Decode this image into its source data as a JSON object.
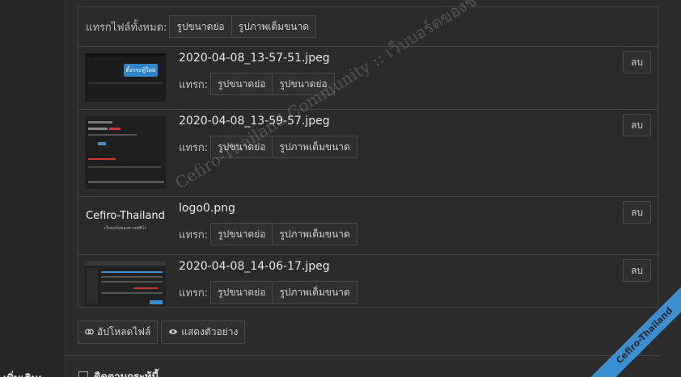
{
  "insert_all": {
    "label": "แทรกไฟล์ทั้งหมด:",
    "thumbnail_btn": "รูปขนาดย่อ",
    "fullsize_btn": "รูปภาพเต็มขนาด"
  },
  "files": [
    {
      "name": "2020-04-08_13-57-51.jpeg",
      "insert_label": "แทรก:",
      "btn1": "รูปขนาดย่อ",
      "btn2": "รูปขนาดย่อ",
      "delete": "ลบ",
      "thumb_caption": "ตั้งกระทู้ใหม่"
    },
    {
      "name": "2020-04-08_13-59-57.jpeg",
      "insert_label": "แทรก:",
      "btn1": "รูปขนาดย่อ",
      "btn2": "รูปภาพเต็มขนาด",
      "delete": "ลบ"
    },
    {
      "name": "logo0.png",
      "insert_label": "แทรก:",
      "btn1": "รูปขนาดย่อ",
      "btn2": "รูปภาพเต็มขนาด",
      "delete": "ลบ",
      "logo_title": "Cefiro-Thailand",
      "logo_subtitle": "เว็บบอร์ดของชาวเซฟิโร่"
    },
    {
      "name": "2020-04-08_14-06-17.jpeg",
      "insert_label": "แทรก:",
      "btn1": "รูปขนาดย่อ",
      "btn2": "รูปภาพเต็มขนาด",
      "delete": "ลบ"
    }
  ],
  "actions": {
    "upload": "อัปโหลดไฟล์",
    "preview": "แสดงตัวอย่าง"
  },
  "options": {
    "more_label": "เพิ่มเติม:",
    "follow_label": "ติดตามกระทู้นี้"
  },
  "watermark": "Cefiro-Thailand Community :: เว็บบอร์ดของชาวเซฟิโร่",
  "ribbon": "Cefiro-Thailand",
  "colors": {
    "accent": "#3a8fd0",
    "background": "#2c2c2c",
    "border": "#454545"
  }
}
